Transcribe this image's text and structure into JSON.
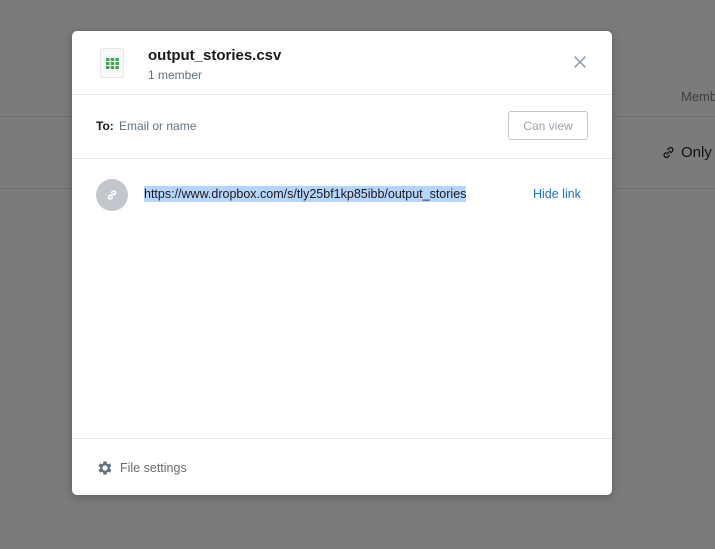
{
  "background": {
    "members_header": "Memb",
    "sharing_status": "Only"
  },
  "modal": {
    "file_name": "output_stories.csv",
    "member_count": "1 member",
    "icons": {
      "file": "spreadsheet-file-icon",
      "close": "close-icon",
      "link": "link-icon",
      "settings": "gear-icon"
    },
    "to_label": "To:",
    "to_placeholder": "Email or name",
    "permission_button": "Can view",
    "shared_link": "https://www.dropbox.com/s/tly25bf1kp85ibb/output_stories",
    "hide_link": "Hide link",
    "file_settings": "File settings"
  },
  "colors": {
    "overlay": "#7b7b7b",
    "accent": "#1a73c7",
    "link_highlight": "#b4d5fe",
    "spreadsheet_green": "#3ea952"
  }
}
